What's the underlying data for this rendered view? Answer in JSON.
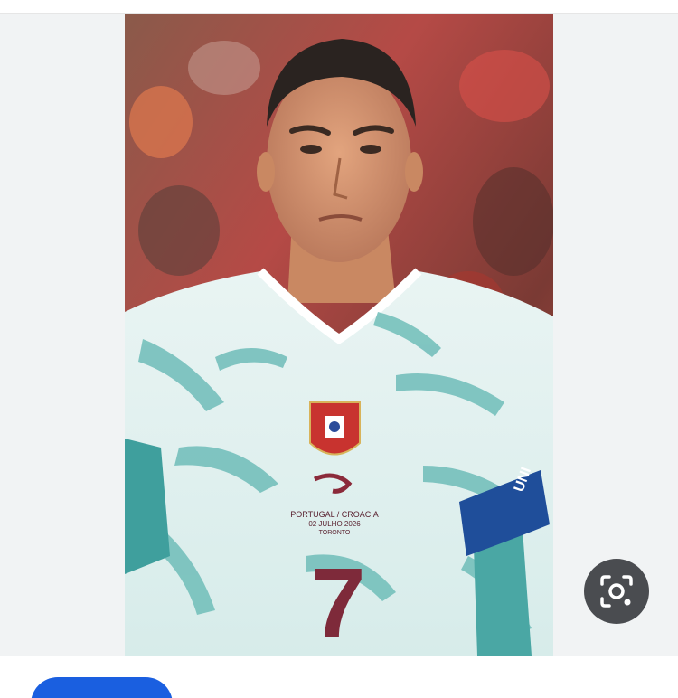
{
  "viewer": {
    "image_alt": "Footballer in a white and teal patterned jersey with number 7",
    "jersey": {
      "number": "7",
      "match_text": "PORTUGAL / CROACIA",
      "date_text": "02 JULHO 2026",
      "city_text": "TORONTO",
      "armband_text": "UNI"
    }
  },
  "lens": {
    "icon": "lens-search-icon",
    "color": "#4a4c50"
  },
  "bottom_bar": {
    "action_button_color": "#1a5fe0",
    "caption": ""
  }
}
